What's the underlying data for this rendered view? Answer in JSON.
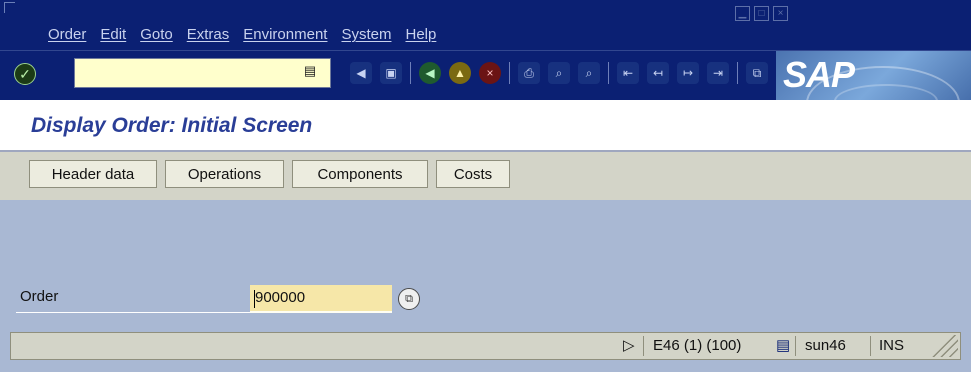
{
  "menubar": {
    "items": [
      "Order",
      "Edit",
      "Goto",
      "Extras",
      "Environment",
      "System",
      "Help"
    ]
  },
  "logo_text": "SAP",
  "title": "Display Order: Initial Screen",
  "app_toolbar": {
    "buttons": [
      "Header data",
      "Operations",
      "Components",
      "Costs"
    ]
  },
  "form": {
    "order_label": "Order",
    "order_value": "900000"
  },
  "status": {
    "system": "E46 (1) (100)",
    "server": "sun46",
    "mode": "INS"
  },
  "icons": {
    "enter": "enter-icon",
    "back": "back-icon",
    "exit": "exit-icon",
    "cancel": "cancel-icon",
    "print": "print-icon",
    "find": "find-icon",
    "find_next": "find-next-icon",
    "save": "save-icon",
    "create_session": "create-session-icon",
    "shortcut": "shortcut-icon",
    "layout": "layout-icon",
    "possible_entries": "possible-entries-icon"
  }
}
